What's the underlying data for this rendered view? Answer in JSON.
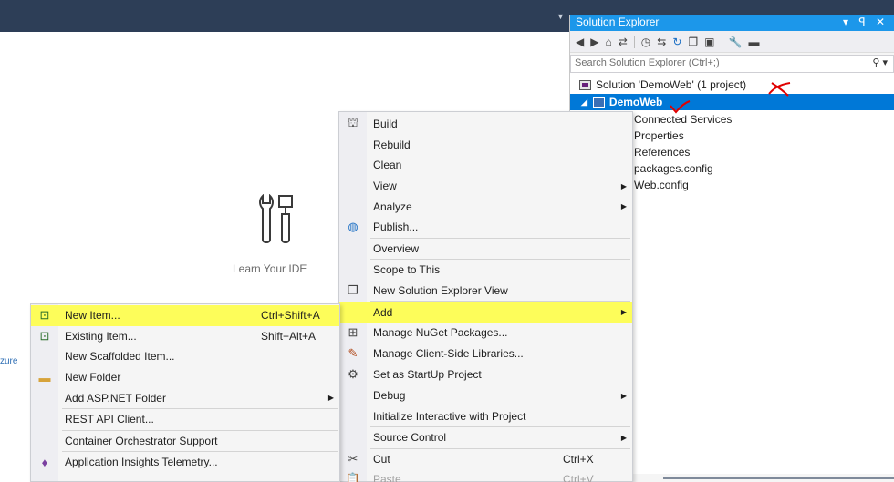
{
  "start_page": {
    "learn_label": "Learn Your IDE",
    "azure_fragment": "zure"
  },
  "solution_explorer": {
    "title": "Solution Explorer",
    "title_buttons": "▾ ꟼ ✕",
    "search_placeholder": "Search Solution Explorer (Ctrl+;)",
    "solution_label": "Solution 'DemoWeb' (1 project)",
    "project_label": "DemoWeb",
    "items": [
      {
        "label": "Connected Services"
      },
      {
        "label": "Properties"
      },
      {
        "label": "References"
      },
      {
        "label": "packages.config"
      },
      {
        "label": "Web.config"
      }
    ]
  },
  "project_menu": {
    "items": [
      {
        "label": "Build",
        "icon": "build-icon"
      },
      {
        "label": "Rebuild"
      },
      {
        "label": "Clean"
      },
      {
        "label": "View",
        "submenu": true
      },
      {
        "label": "Analyze",
        "submenu": true
      },
      {
        "label": "Publish...",
        "icon": "globe-icon"
      },
      {
        "label": "Overview"
      },
      {
        "label": "Scope to This"
      },
      {
        "label": "New Solution Explorer View",
        "icon": "new-view-icon"
      },
      {
        "label": "Add",
        "submenu": true,
        "highlighted": true
      },
      {
        "label": "Manage NuGet Packages...",
        "icon": "nuget-icon"
      },
      {
        "label": "Manage Client-Side Libraries...",
        "icon": "libraries-icon"
      },
      {
        "label": "Set as StartUp Project",
        "icon": "gear-icon"
      },
      {
        "label": "Debug",
        "submenu": true
      },
      {
        "label": "Initialize Interactive with Project"
      },
      {
        "label": "Source Control",
        "submenu": true
      },
      {
        "label": "Cut",
        "icon": "cut-icon",
        "shortcut": "Ctrl+X"
      },
      {
        "label": "Paste",
        "icon": "paste-icon",
        "shortcut": "Ctrl+V"
      }
    ]
  },
  "add_menu": {
    "items": [
      {
        "label": "New Item...",
        "shortcut": "Ctrl+Shift+A",
        "highlighted": true,
        "icon": "new-item-icon"
      },
      {
        "label": "Existing Item...",
        "shortcut": "Shift+Alt+A",
        "icon": "existing-item-icon"
      },
      {
        "label": "New Scaffolded Item..."
      },
      {
        "label": "New Folder",
        "icon": "folder-icon"
      },
      {
        "label": "Add ASP.NET Folder",
        "submenu": true
      },
      {
        "label": "REST API Client..."
      },
      {
        "label": "Container Orchestrator Support"
      },
      {
        "label": "Application Insights Telemetry...",
        "icon": "app-insights-icon"
      }
    ]
  },
  "colors": {
    "topbar": "#2d3e57",
    "accent": "#1c97ea",
    "selection": "#0078d7",
    "highlight": "#fdfd5a",
    "annotation": "#e00000"
  }
}
